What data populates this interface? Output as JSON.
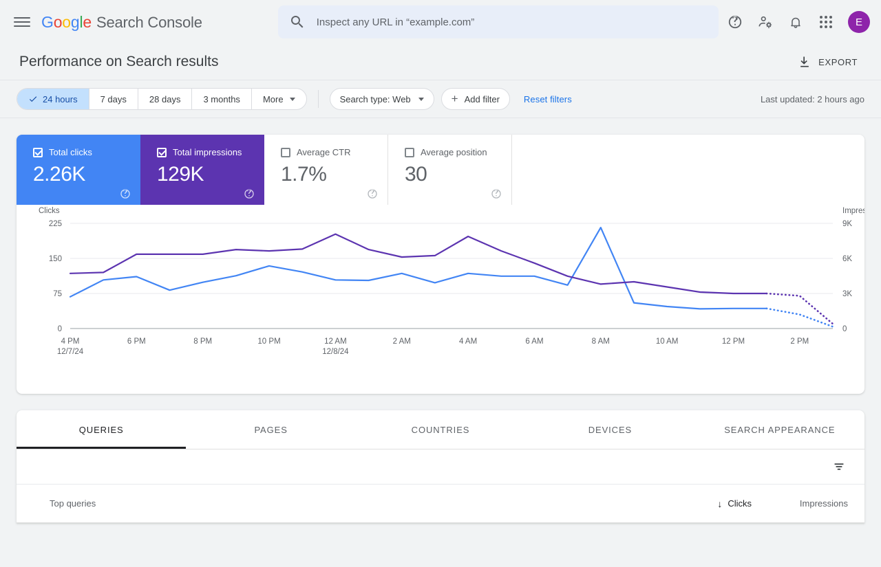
{
  "header": {
    "menu_icon": "hamburger-menu-icon",
    "logo_letters": [
      "G",
      "o",
      "o",
      "g",
      "l",
      "e"
    ],
    "brand_name": "Search Console",
    "search_placeholder": "Inspect any URL in “example.com”",
    "search_value": "",
    "search_icon": "search-icon",
    "help_icon": "help-circle-icon",
    "account_settings_icon": "person-gear-icon",
    "notifications_icon": "bell-icon",
    "apps_icon": "apps-grid-icon",
    "avatar_letter": "E",
    "avatar_color": "#8e24aa"
  },
  "page": {
    "title": "Performance on Search results",
    "export_label": "EXPORT",
    "export_icon": "download-icon"
  },
  "filters": {
    "date_ranges": [
      {
        "label": "24 hours",
        "active": true
      },
      {
        "label": "7 days",
        "active": false
      },
      {
        "label": "28 days",
        "active": false
      },
      {
        "label": "3 months",
        "active": false
      },
      {
        "label": "More",
        "active": false,
        "has_caret": true
      }
    ],
    "search_type_label": "Search type: Web",
    "add_filter_label": "Add filter",
    "reset_label": "Reset filters",
    "last_updated": "Last updated: 2 hours ago"
  },
  "metrics": [
    {
      "label": "Total clicks",
      "value": "2.26K",
      "checked": true,
      "color": "#4285F4"
    },
    {
      "label": "Total impressions",
      "value": "129K",
      "checked": true,
      "color": "#5c34b0"
    },
    {
      "label": "Average CTR",
      "value": "1.7%",
      "checked": false,
      "color": "#5f6368"
    },
    {
      "label": "Average position",
      "value": "30",
      "checked": false,
      "color": "#5f6368"
    }
  ],
  "chart_data": {
    "type": "line",
    "title": "",
    "xlabel": "",
    "ylabel": "Clicks",
    "y2label": "Impressions",
    "grid": true,
    "legend_position": "none",
    "left_axis_label": "Clicks",
    "right_axis_label": "Impressions",
    "yticks": [
      0,
      75,
      150,
      225
    ],
    "ytick_labels": [
      "0",
      "75",
      "150",
      "225"
    ],
    "ylim": [
      0,
      225
    ],
    "y2ticks": [
      0,
      3000,
      6000,
      9000
    ],
    "y2tick_labels": [
      "0",
      "3K",
      "6K",
      "9K"
    ],
    "y2lim": [
      0,
      9000
    ],
    "x_tick_labels": [
      "4 PM",
      "6 PM",
      "8 PM",
      "10 PM",
      "12 AM",
      "2 AM",
      "4 AM",
      "6 AM",
      "8 AM",
      "10 AM",
      "12 PM",
      "2 PM"
    ],
    "x_tick_sublabels": [
      "12/7/24",
      "",
      "",
      "",
      "12/8/24",
      "",
      "",
      "",
      "",
      "",
      "",
      ""
    ],
    "x": [
      "4 PM",
      "5 PM",
      "6 PM",
      "7 PM",
      "8 PM",
      "9 PM",
      "10 PM",
      "11 PM",
      "12 AM",
      "1 AM",
      "2 AM",
      "3 AM",
      "4 AM",
      "5 AM",
      "6 AM",
      "7 AM",
      "8 AM",
      "9 AM",
      "10 AM",
      "11 AM",
      "12 PM",
      "1 PM",
      "2 PM",
      "3 PM"
    ],
    "dashed_from_index": 21,
    "series": [
      {
        "name": "Clicks",
        "color": "#4285F4",
        "axis": "left",
        "values": [
          68,
          104,
          111,
          82,
          99,
          113,
          134,
          121,
          104,
          103,
          118,
          98,
          118,
          112,
          112,
          93,
          216,
          55,
          47,
          42,
          43,
          43,
          30,
          4
        ]
      },
      {
        "name": "Impressions",
        "color": "#5c34b0",
        "axis": "right",
        "values": [
          4720,
          4800,
          6360,
          6360,
          6360,
          6760,
          6640,
          6800,
          8080,
          6760,
          6120,
          6240,
          7880,
          6640,
          5600,
          4480,
          3800,
          4000,
          3560,
          3120,
          3000,
          3000,
          2800,
          400
        ]
      }
    ]
  },
  "tabs": [
    {
      "label": "QUERIES",
      "active": true
    },
    {
      "label": "PAGES",
      "active": false
    },
    {
      "label": "COUNTRIES",
      "active": false
    },
    {
      "label": "DEVICES",
      "active": false
    },
    {
      "label": "SEARCH APPEARANCE",
      "active": false
    }
  ],
  "table": {
    "filter_icon": "filter-list-icon",
    "col_query": "Top queries",
    "col_clicks": "Clicks",
    "col_impressions": "Impressions",
    "sort_icon": "arrow-down-icon",
    "rows": []
  }
}
